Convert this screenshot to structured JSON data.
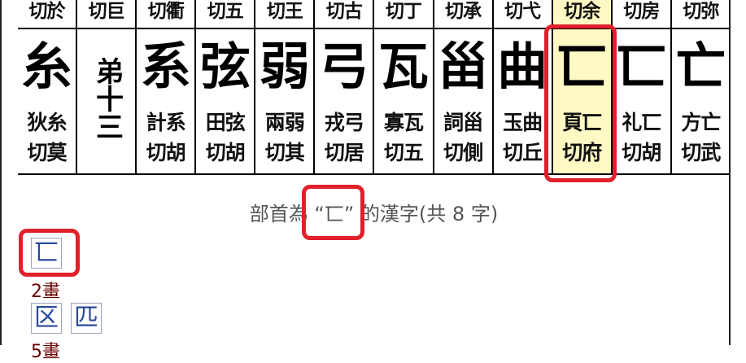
{
  "strip": {
    "cells": [
      {
        "top": "切於",
        "glyph": "糸",
        "bottom": [
          "狄糸",
          "切莫"
        ]
      },
      {
        "top": "切巨",
        "glyph": "弟十三",
        "bottom": [
          "",
          ""
        ]
      },
      {
        "top": "切衢",
        "glyph": "系",
        "bottom": [
          "計系",
          "切胡"
        ]
      },
      {
        "top": "切五",
        "glyph": "弦",
        "bottom": [
          "田弦",
          "切胡"
        ]
      },
      {
        "top": "切王",
        "glyph": "弱",
        "bottom": [
          "兩弱",
          "切其"
        ]
      },
      {
        "top": "切古",
        "glyph": "弓",
        "bottom": [
          "戎弓",
          "切居"
        ]
      },
      {
        "top": "切丁",
        "glyph": "瓦",
        "bottom": [
          "寡瓦",
          "切五"
        ]
      },
      {
        "top": "切承",
        "glyph": "甾",
        "bottom": [
          "詞甾",
          "切側"
        ]
      },
      {
        "top": "切弋",
        "glyph": "曲",
        "bottom": [
          "玉曲",
          "切丘"
        ]
      },
      {
        "top": "切余",
        "glyph": "匸",
        "bottom": [
          "頁匸",
          "切府"
        ]
      },
      {
        "top": "切房",
        "glyph": "匸",
        "bottom": [
          "礼匸",
          "切胡"
        ]
      },
      {
        "top": "切弥",
        "glyph": "亡",
        "bottom": [
          "方亡",
          "切武"
        ]
      }
    ]
  },
  "heading": {
    "prefix": "部首為",
    "radical": "“匸”",
    "suffix": "的漢字(共 8 字)"
  },
  "radical_char": "匸",
  "groups": [
    {
      "strokes": "2畫",
      "chars": [
        "区",
        "匹"
      ]
    },
    {
      "strokes": "5畫",
      "chars": []
    }
  ]
}
